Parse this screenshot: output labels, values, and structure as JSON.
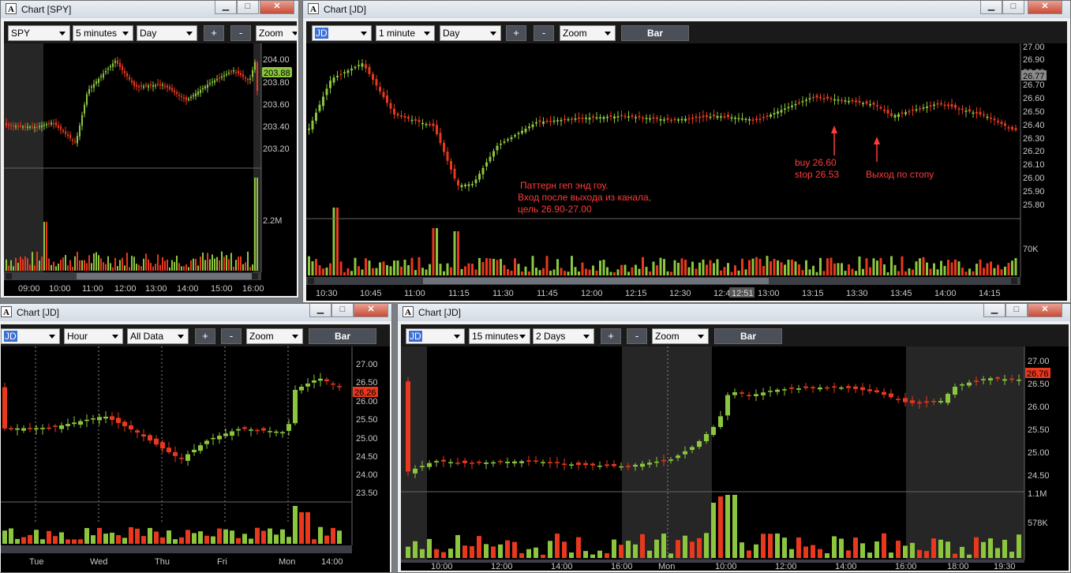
{
  "colors": {
    "up": "#8cc63e",
    "down": "#e8381e",
    "axis": "#c9c9c9",
    "annot": "#ff3b3b"
  },
  "w1": {
    "title": "Chart [SPY]",
    "symbol": "SPY",
    "interval": "5 minutes",
    "range": "Day",
    "zoom": "Zoom",
    "price_ticks": [
      "204.00",
      "203.80",
      "203.60",
      "203.40",
      "203.20"
    ],
    "last_price": "203.88",
    "vol_tick": "2.2M",
    "time_ticks": [
      "09:00",
      "10:00",
      "11:00",
      "12:00",
      "13:00",
      "14:00",
      "15:00",
      "16:00"
    ]
  },
  "w2": {
    "title": "Chart [JD]",
    "symbol": "JD",
    "interval": "1 minute",
    "range": "Day",
    "zoom": "Zoom",
    "bar": "Bar",
    "price_ticks": [
      "27.00",
      "26.90",
      "26.80",
      "26.70",
      "26.60",
      "26.50",
      "26.40",
      "26.30",
      "26.20",
      "26.10",
      "26.00",
      "25.90",
      "25.80"
    ],
    "last_price": "26.77",
    "vol_tick": "70K",
    "time_ticks": [
      "10:30",
      "10:45",
      "11:00",
      "11:15",
      "11:30",
      "11:45",
      "12:00",
      "12:15",
      "12:30",
      "12:45",
      "13:00",
      "13:15",
      "13:30",
      "13:45",
      "14:00",
      "14:15"
    ],
    "cursor_time": "12:51",
    "annotations": {
      "pattern_line1": "Паттерн геп энд гоу.",
      "pattern_line2": "Вход после выхода из канала,",
      "pattern_line3": "цель 26.90-27.00",
      "buy_line1": "buy 26.60",
      "buy_line2": "stop 26.53",
      "exit": "Выход по стопу"
    }
  },
  "w3": {
    "title": "Chart [JD]",
    "symbol": "JD",
    "interval": "Hour",
    "range": "All Data",
    "zoom": "Zoom",
    "bar": "Bar",
    "price_ticks": [
      "27.00",
      "26.50",
      "26.00",
      "25.50",
      "25.00",
      "24.50",
      "24.00",
      "23.50"
    ],
    "last_price": "26.26",
    "time_ticks": [
      "Tue",
      "Wed",
      "Thu",
      "Fri",
      "Mon",
      "14:00"
    ]
  },
  "w4": {
    "title": "Chart [JD]",
    "symbol": "JD",
    "interval": "15 minutes",
    "range": "2 Days",
    "zoom": "Zoom",
    "bar": "Bar",
    "price_ticks": [
      "27.00",
      "26.50",
      "26.00",
      "25.50",
      "25.00",
      "24.50"
    ],
    "last_price": "26.76",
    "vol_ticks": [
      "1.1M",
      "578K"
    ],
    "time_ticks": [
      "10:00",
      "12:00",
      "14:00",
      "16:00",
      "Mon",
      "10:00",
      "12:00",
      "14:00",
      "16:00",
      "18:00",
      "19:30"
    ]
  }
}
